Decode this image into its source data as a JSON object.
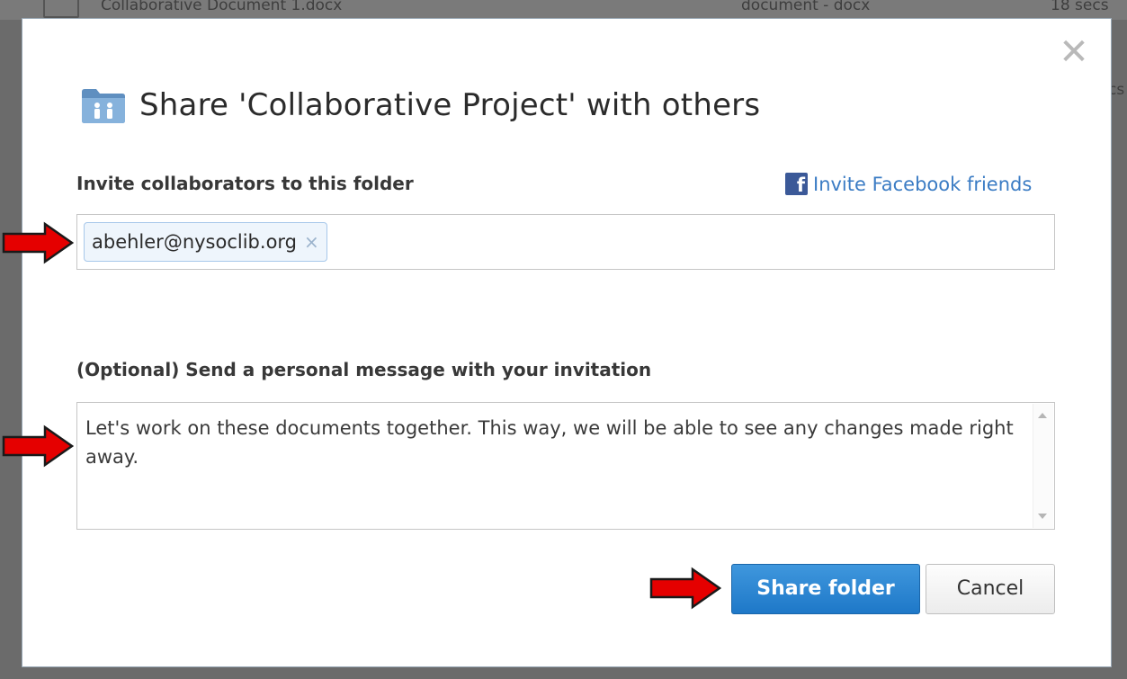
{
  "background": {
    "row_name": "Collaborative Document 1.docx",
    "row_type": "document - docx",
    "row_time": "18 secs",
    "side_text": "cs"
  },
  "dialog": {
    "title": "Share 'Collaborative Project' with others",
    "close_glyph": "✕",
    "invite_label": "Invite collaborators to this folder",
    "facebook_link": "Invite Facebook friends",
    "facebook_glyph": "f",
    "collaborators": [
      {
        "email": "abehler@nysoclib.org",
        "remove_glyph": "×"
      }
    ],
    "message_label": "(Optional) Send a personal message with your invitation",
    "message_text": "Let's work on these documents together. This way, we will be able to see any changes made right away.",
    "share_button": "Share folder",
    "cancel_button": "Cancel"
  },
  "icons": {
    "folder": "shared-folder-icon",
    "close": "close-icon",
    "facebook": "facebook-icon",
    "annotation": "red-arrow-icon"
  },
  "colors": {
    "accent": "#1e78c8",
    "link": "#3b7cc4",
    "facebook": "#3b5998",
    "annotation_arrow": "#e50000"
  }
}
